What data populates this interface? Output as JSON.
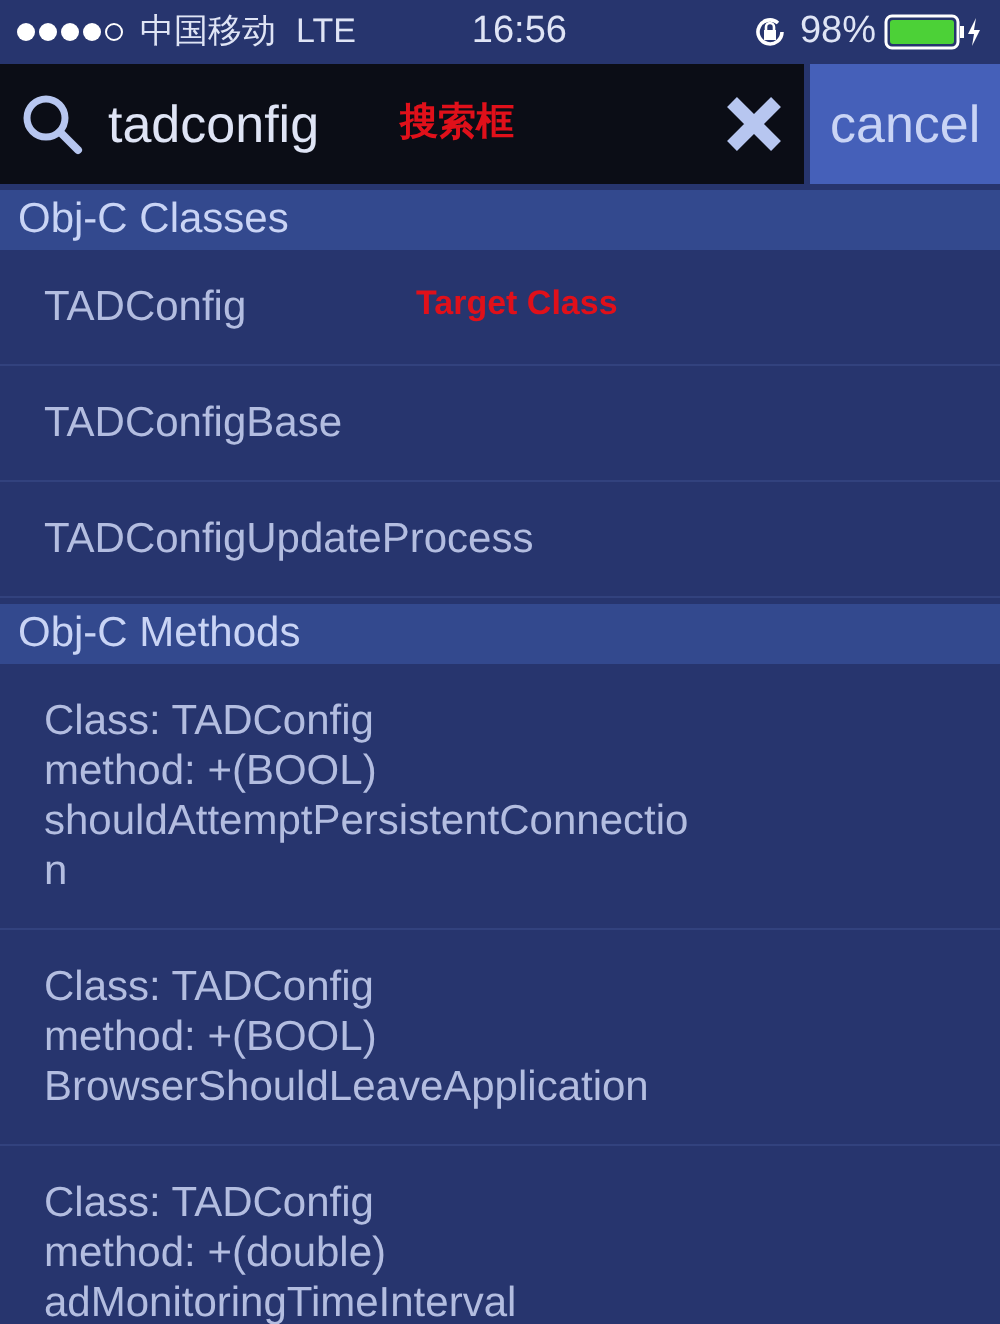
{
  "status_bar": {
    "carrier": "中国移动",
    "network": "LTE",
    "time": "16:56",
    "battery": "98%"
  },
  "search": {
    "value": "tadconfig",
    "cancel": "cancel",
    "annotation": "搜索框"
  },
  "sections": [
    {
      "title": "Obj-C Classes",
      "kind": "classes",
      "items": [
        {
          "lines": [
            "TADConfig"
          ],
          "annotation": "Target Class"
        },
        {
          "lines": [
            "TADConfigBase"
          ]
        },
        {
          "lines": [
            "TADConfigUpdateProcess"
          ]
        }
      ]
    },
    {
      "title": "Obj-C Methods",
      "kind": "methods",
      "items": [
        {
          "lines": [
            "Class: TADConfig",
            "method: +(BOOL)",
            "shouldAttemptPersistentConnectio",
            "n"
          ]
        },
        {
          "lines": [
            "Class: TADConfig",
            "method: +(BOOL)",
            "BrowserShouldLeaveApplication"
          ]
        },
        {
          "lines": [
            "Class: TADConfig",
            "method: +(double)",
            "adMonitoringTimeInterval"
          ]
        }
      ]
    }
  ]
}
